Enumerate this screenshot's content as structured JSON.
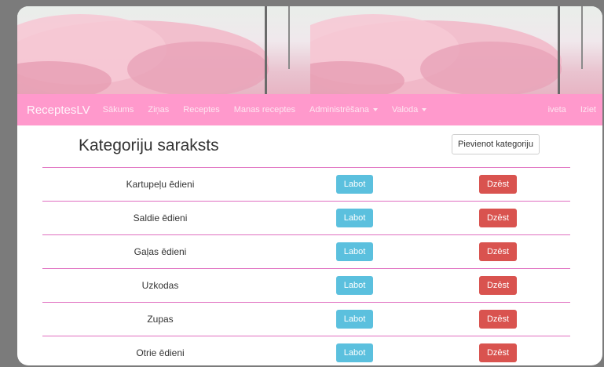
{
  "navbar": {
    "brand": "ReceptesLV",
    "items": [
      "Sākums",
      "Ziņas",
      "Receptes",
      "Manas receptes"
    ],
    "dropdowns": [
      "Administrēšana",
      "Valoda"
    ],
    "right": [
      "iveta",
      "Iziet"
    ]
  },
  "main": {
    "title": "Kategoriju saraksts",
    "add_button": "Pievienot kategoriju",
    "rows": [
      {
        "name": "Kartupeļu ēdieni",
        "edit": "Labot",
        "delete": "Dzēst"
      },
      {
        "name": "Saldie ēdieni",
        "edit": "Labot",
        "delete": "Dzēst"
      },
      {
        "name": "Gaļas ēdieni",
        "edit": "Labot",
        "delete": "Dzēst"
      },
      {
        "name": "Uzkodas",
        "edit": "Labot",
        "delete": "Dzēst"
      },
      {
        "name": "Zupas",
        "edit": "Labot",
        "delete": "Dzēst"
      },
      {
        "name": "Otrie ēdieni",
        "edit": "Labot",
        "delete": "Dzēst"
      }
    ]
  },
  "colors": {
    "navbar": "#ff99cc",
    "row_border": "#e06fc0",
    "edit_button": "#5bc0de",
    "delete_button": "#d9534f"
  }
}
